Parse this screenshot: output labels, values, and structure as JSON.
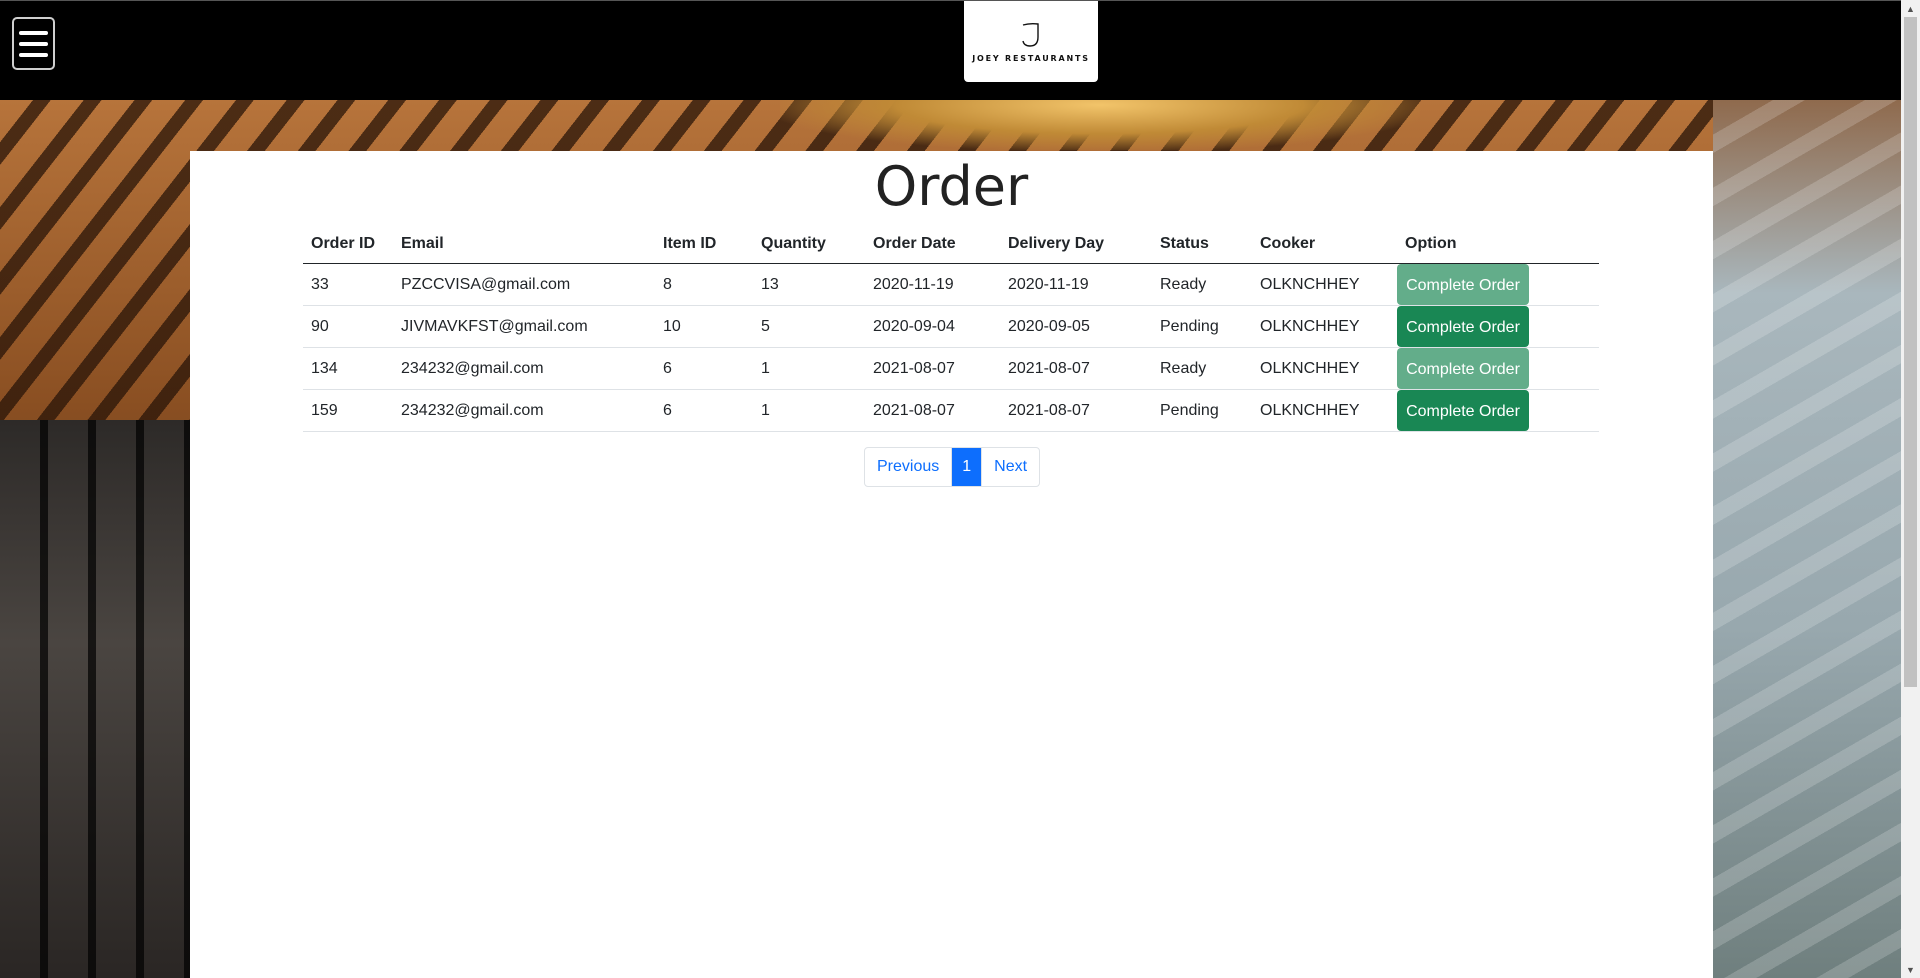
{
  "header": {
    "brand": "JOEY RESTAURANTS",
    "menu_icon": "hamburger-icon"
  },
  "page": {
    "title": "Order"
  },
  "table": {
    "columns": [
      "Order ID",
      "Email",
      "Item ID",
      "Quantity",
      "Order Date",
      "Delivery Day",
      "Status",
      "Cooker",
      "Option"
    ],
    "rows": [
      {
        "order_id": "33",
        "email": "PZCCVISA@gmail.com",
        "item_id": "8",
        "quantity": "13",
        "order_date": "2020-11-19",
        "delivery_day": "2020-11-19",
        "status": "Ready",
        "cooker": "OLKNCHHEY",
        "option": "Complete Order"
      },
      {
        "order_id": "90",
        "email": "JIVMAVKFST@gmail.com",
        "item_id": "10",
        "quantity": "5",
        "order_date": "2020-09-04",
        "delivery_day": "2020-09-05",
        "status": "Pending",
        "cooker": "OLKNCHHEY",
        "option": "Complete Order"
      },
      {
        "order_id": "134",
        "email": "234232@gmail.com",
        "item_id": "6",
        "quantity": "1",
        "order_date": "2021-08-07",
        "delivery_day": "2021-08-07",
        "status": "Ready",
        "cooker": "OLKNCHHEY",
        "option": "Complete Order"
      },
      {
        "order_id": "159",
        "email": "234232@gmail.com",
        "item_id": "6",
        "quantity": "1",
        "order_date": "2021-08-07",
        "delivery_day": "2021-08-07",
        "status": "Pending",
        "cooker": "OLKNCHHEY",
        "option": "Complete Order"
      }
    ]
  },
  "pagination": {
    "previous": "Previous",
    "current": "1",
    "next": "Next"
  },
  "colors": {
    "button_green": "#198754",
    "button_green_disabled": "#63ad8a",
    "link_blue": "#0d6efd"
  }
}
